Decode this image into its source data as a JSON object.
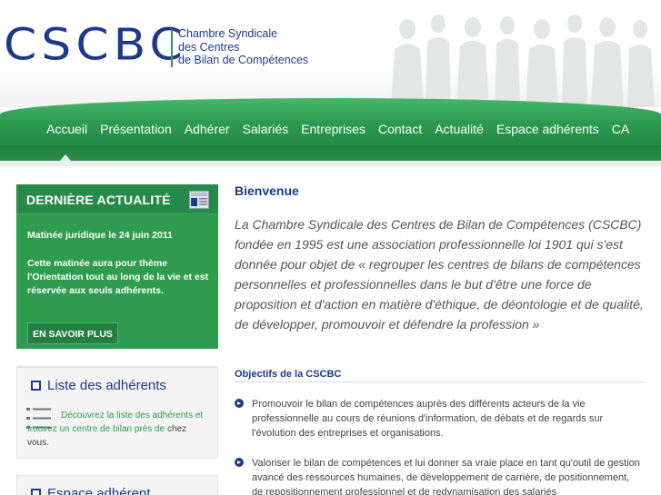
{
  "header": {
    "logo": "CSCBC",
    "org_lines": [
      "Chambre Syndicale",
      "des Centres",
      "de Bilan de Compétences"
    ]
  },
  "nav": {
    "items": [
      "Accueil",
      "Présentation",
      "Adhérer",
      "Salariés",
      "Entreprises",
      "Contact",
      "Actualité",
      "Espace adhérents",
      "CA"
    ],
    "active": "Accueil"
  },
  "sidebar": {
    "news": {
      "title": "DERNIÈRE ACTUALITÉ",
      "date_line": "Matinée juridique le 24 juin 2011",
      "body": "Cette matinée aura pour thème l'Orientation tout au long de la vie et est réservée aux seuls adhérents.",
      "button": "EN SAVOIR PLUS"
    },
    "members": {
      "title": "Liste des adhérents",
      "text_green": "Découvrez la liste des adhérents et trouvez un centre de bilan près de",
      "text_rest": "chez vous."
    },
    "space": {
      "title": "Espace adhérent"
    }
  },
  "main": {
    "title": "Bienvenue",
    "intro": "La Chambre Syndicale des Centres de Bilan de Compétences (CSCBC) fondée en 1995 est une association professionnelle loi 1901 qui s'est donnée pour objet de « regrouper les centres de bilans de compétences personnelles et professionnelles dans le but d'être une force de proposition et d'action en matière d'éthique, de déontologie et de qualité, de développer, promouvoir et défendre la profession »",
    "objectives_title": "Objectifs de la CSCBC",
    "objectives": [
      "Promouvoir le bilan de compétences auprès des différents acteurs de la vie professionnelle au cours de réunions d'information, de débats et de regards sur l'évolution des entreprises et organisations.",
      "Valoriser le bilan de compétences et lui donner sa vraie place en tant qu'outil de gestion avancé des ressources humaines, de développement de carrière, de positionnement, de repositionnement professionnel et de redynamisation des salariés"
    ]
  },
  "colors": {
    "brand_blue": "#1d3a8a",
    "brand_green": "#2e9b4f"
  }
}
